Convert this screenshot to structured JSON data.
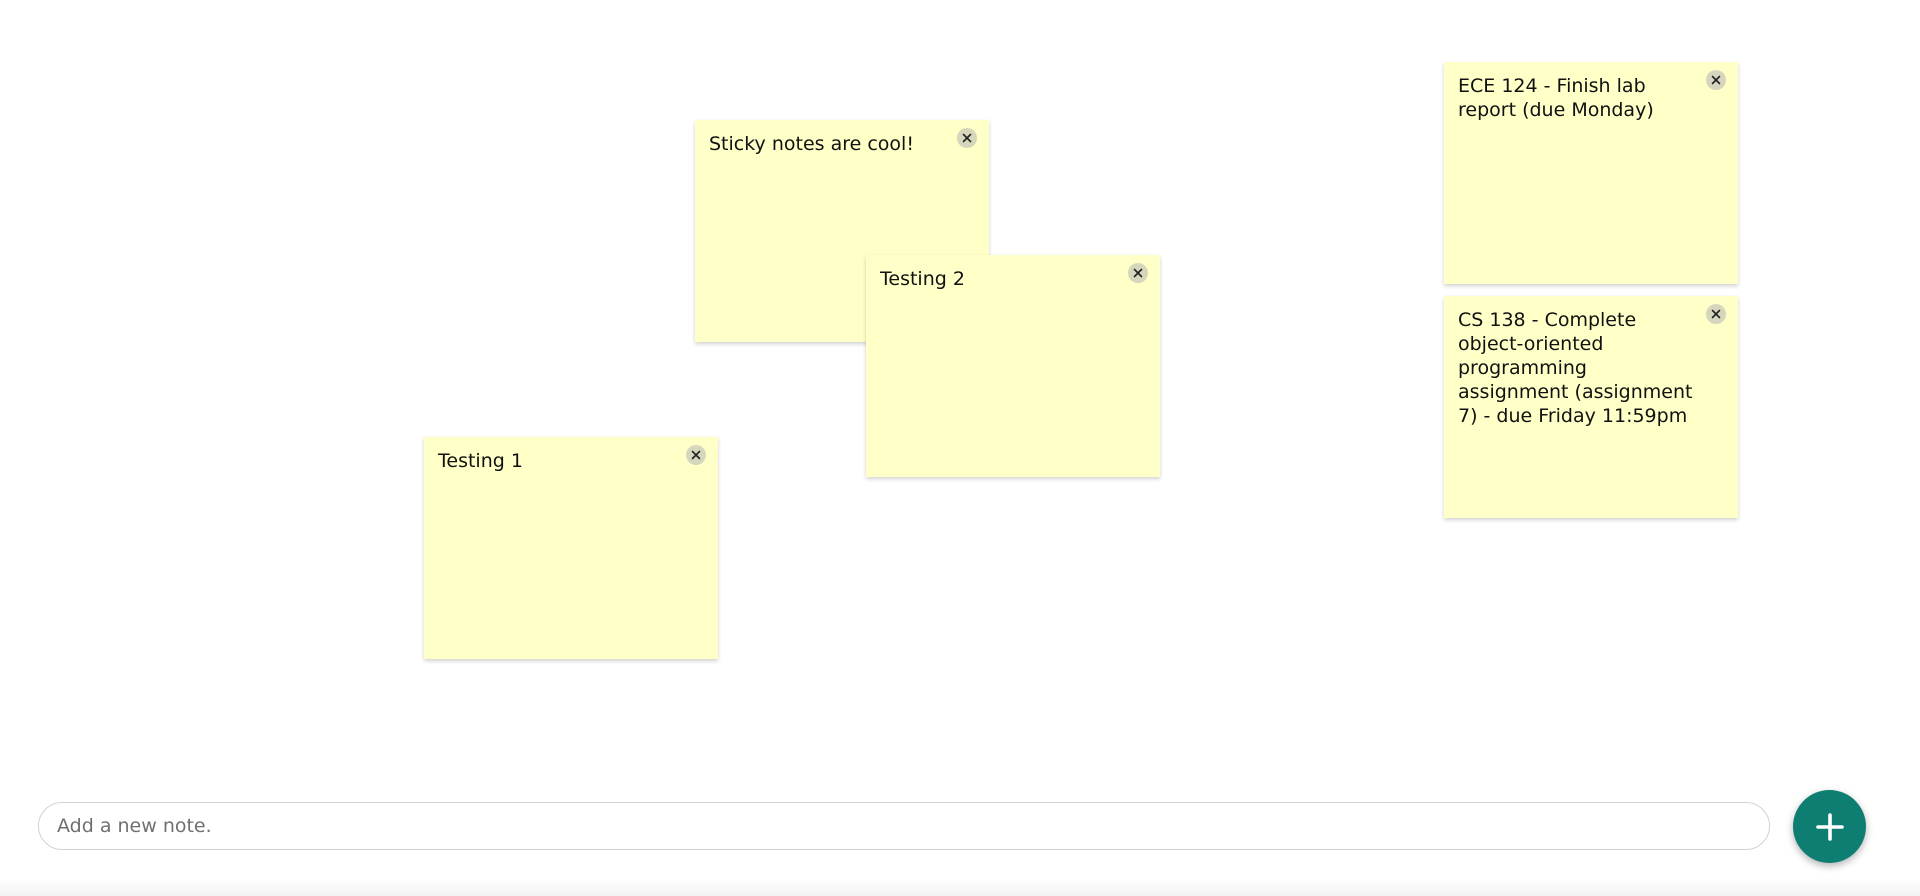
{
  "notes": [
    {
      "id": "note-sticky",
      "text": "Sticky notes are cool!"
    },
    {
      "id": "note-testing2",
      "text": "Testing 2"
    },
    {
      "id": "note-testing1",
      "text": "Testing 1"
    },
    {
      "id": "note-ece",
      "text": "ECE 124 - Finish lab report (due Monday)"
    },
    {
      "id": "note-cs",
      "text": "CS 138 - Complete object-oriented programming assignment (assignment 7) - due Friday 11:59pm"
    }
  ],
  "composer": {
    "placeholder": "Add a new note.",
    "value": ""
  },
  "icons": {
    "close": "close-icon",
    "add": "plus-icon"
  },
  "colors": {
    "note_background": "#ffffc8",
    "add_button": "#0f7e72"
  }
}
